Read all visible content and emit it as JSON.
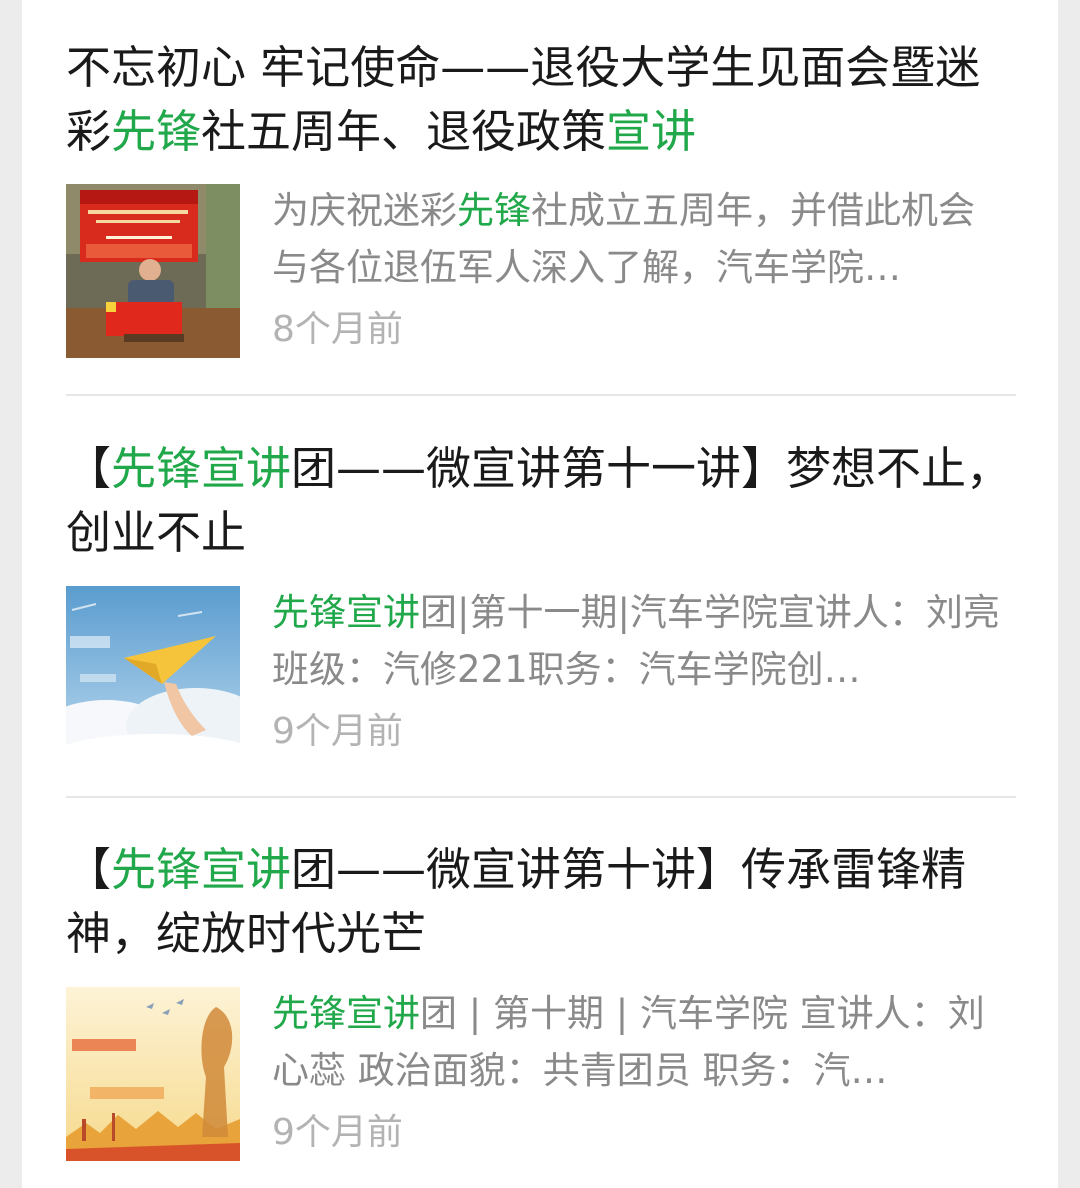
{
  "articles": [
    {
      "title_parts": [
        {
          "text": "不忘初心 牢记使命——退役大学生见面会暨迷彩",
          "hl": false
        },
        {
          "text": "先锋",
          "hl": true
        },
        {
          "text": "社五周年、退役政策",
          "hl": false
        },
        {
          "text": "宣讲",
          "hl": true
        }
      ],
      "snippet_parts": [
        {
          "text": "为庆祝迷彩",
          "hl": false
        },
        {
          "text": "先锋",
          "hl": true
        },
        {
          "text": "社成立五周年，并借此机会与各位退伍军人深入了解，汽车学院…",
          "hl": false
        }
      ],
      "time": "8个月前",
      "thumbnail_icon": "meeting-photo-icon"
    },
    {
      "title_parts": [
        {
          "text": "【",
          "hl": false
        },
        {
          "text": "先锋宣讲",
          "hl": true
        },
        {
          "text": "团——微宣讲第十一讲】梦想不止，创业不止",
          "hl": false
        }
      ],
      "snippet_parts": [
        {
          "text": "先锋宣讲",
          "hl": true
        },
        {
          "text": "团|第十一期|汽车学院宣讲人：刘亮班级：汽修221职务：汽车学院创…",
          "hl": false
        }
      ],
      "time": "9个月前",
      "thumbnail_icon": "paper-plane-sky-icon"
    },
    {
      "title_parts": [
        {
          "text": "【",
          "hl": false
        },
        {
          "text": "先锋宣讲",
          "hl": true
        },
        {
          "text": "团——微宣讲第十讲】传承雷锋精神，绽放时代光芒",
          "hl": false
        }
      ],
      "snippet_parts": [
        {
          "text": "先锋宣讲",
          "hl": true
        },
        {
          "text": "团 | 第十期 | 汽车学院 宣讲人：刘心蕊 政治面貌：共青团员 职务：汽…",
          "hl": false
        }
      ],
      "time": "9个月前",
      "thumbnail_icon": "leifeng-poster-icon"
    }
  ],
  "colors": {
    "highlight": "#20a84a",
    "title": "#1a1a1a",
    "snippet": "#8a8a8a",
    "time": "#b3b3b3",
    "background": "#ececec"
  }
}
